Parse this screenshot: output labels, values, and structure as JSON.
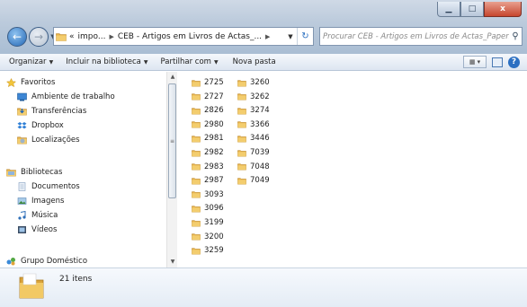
{
  "window": {
    "minimize_icon": "minimize-icon",
    "maximize_icon": "maximize-icon",
    "close_label": "x"
  },
  "address": {
    "prefix": "«",
    "segments": [
      "impo...",
      "CEB - Artigos em Livros de Actas_..."
    ]
  },
  "search": {
    "placeholder": "Procurar CEB - Artigos em Livros de Actas_Papers..."
  },
  "toolbar": {
    "organize": "Organizar",
    "include": "Incluir na biblioteca",
    "share": "Partilhar com",
    "new_folder": "Nova pasta"
  },
  "sidebar": {
    "favorites": {
      "label": "Favoritos",
      "items": [
        "Ambiente de trabalho",
        "Transferências",
        "Dropbox",
        "Localizações"
      ]
    },
    "libraries": {
      "label": "Bibliotecas",
      "items": [
        "Documentos",
        "Imagens",
        "Música",
        "Vídeos"
      ]
    },
    "homegroup": "Grupo Doméstico"
  },
  "folders": {
    "col1": [
      "2725",
      "2727",
      "2826",
      "2980",
      "2981",
      "2982",
      "2983",
      "2987",
      "3093",
      "3096",
      "3199",
      "3200",
      "3259"
    ],
    "col2": [
      "3260",
      "3262",
      "3274",
      "3366",
      "3446",
      "7039",
      "7048",
      "7049"
    ]
  },
  "details": {
    "count": "21 itens"
  },
  "colors": {
    "folder": "#e8b64c",
    "accent": "#2b6fc2",
    "titlebar": "#bccbdc"
  }
}
